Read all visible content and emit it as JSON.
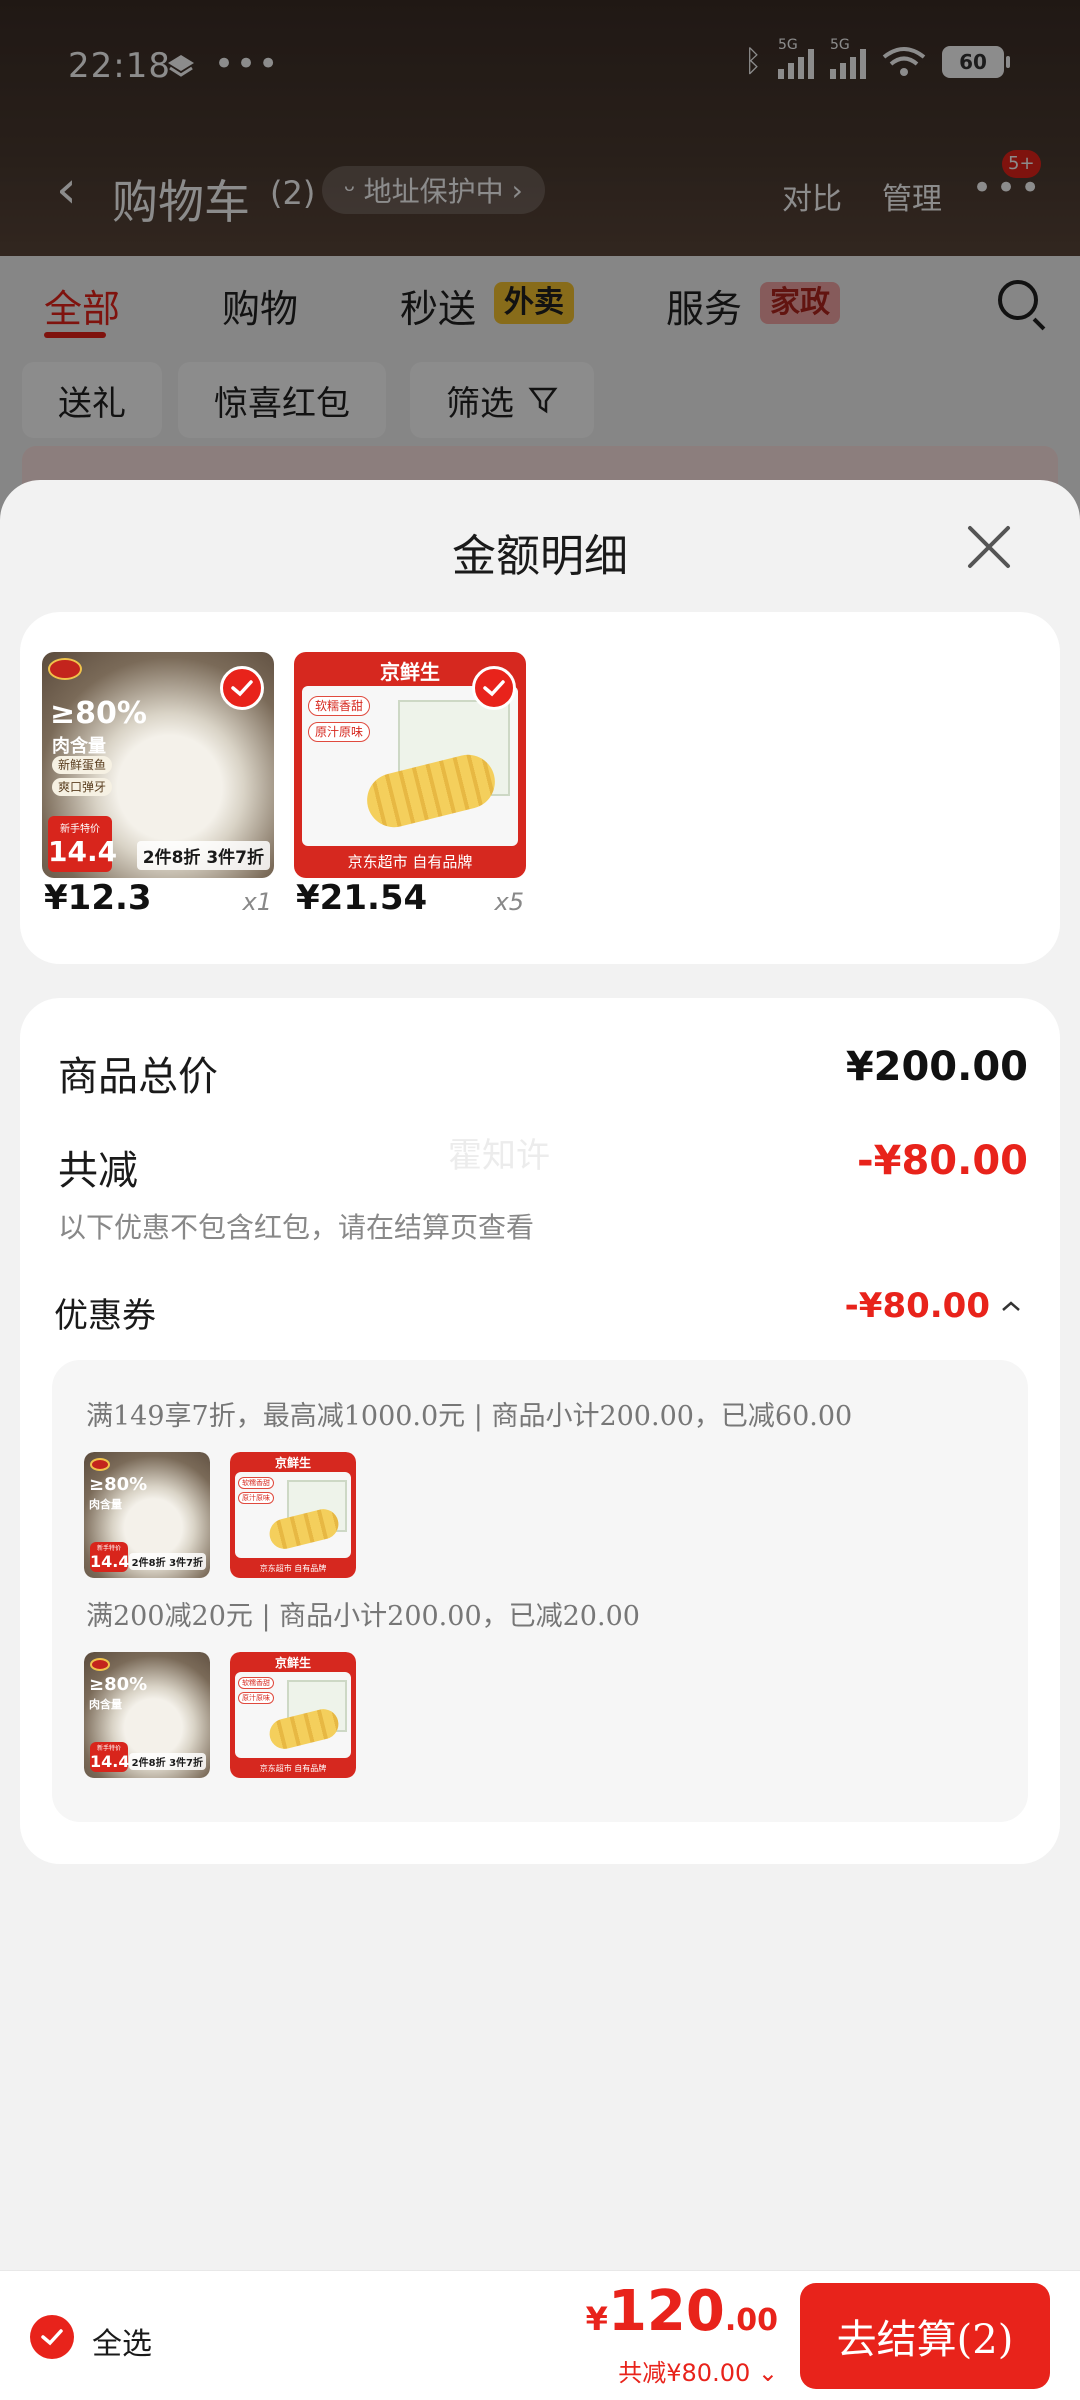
{
  "status_bar": {
    "time": "22:18",
    "dots": "•••",
    "net_tag_1": "5G",
    "net_tag_2": "5G",
    "wifi_tag": "6",
    "battery": "60"
  },
  "header": {
    "title": "购物车",
    "count": "(2)",
    "address_pill": "地址保护中",
    "compare": "对比",
    "manage": "管理",
    "more_badge": "5+"
  },
  "tabs": [
    {
      "label": "全部",
      "active": true
    },
    {
      "label": "购物"
    },
    {
      "label": "秒送",
      "tag": "外卖"
    },
    {
      "label": "服务",
      "tag": "家政"
    }
  ],
  "chips": [
    "送礼",
    "惊喜红包",
    "筛选"
  ],
  "sheet": {
    "title": "金额明细",
    "products": [
      {
        "price": "¥12.3",
        "qty": "x1",
        "image": {
          "pct": "≥80%",
          "pct_sub": "肉含量",
          "tag1": "新鲜蛋鱼",
          "tag2": "爽口弹牙",
          "flag_small": "新手特价",
          "flag_big": "14.4",
          "deal": "2件8折 3件7折"
        }
      },
      {
        "price": "¥21.54",
        "qty": "x5",
        "image": {
          "brand": "京鲜生",
          "tag1": "软糯香甜",
          "tag2": "原汁原味",
          "bottom": "京东超市 自有品牌"
        }
      }
    ],
    "summary": {
      "total_label": "商品总价",
      "total_value": "¥200.00",
      "discount_label": "共减",
      "discount_value": "-¥80.00",
      "note": "以下优惠不包含红包，请在结算页查看",
      "watermark": "霍知许",
      "coupon_label": "优惠券",
      "coupon_value": "-¥80.00",
      "coupon_rules": [
        "满149享7折，最高减1000.0元 | 商品小计200.00，已减60.00",
        "满200减20元 | 商品小计200.00，已减20.00"
      ]
    }
  },
  "bottom_bar": {
    "select_all": "全选",
    "currency": "¥",
    "total_int": "120",
    "total_dec": ".00",
    "discount": "共减¥80.00",
    "checkout": "去结算(2)"
  },
  "colors": {
    "accent": "#e8231b",
    "header_bg": "#4a3a30",
    "sheet_bg": "#f2f2f2"
  }
}
